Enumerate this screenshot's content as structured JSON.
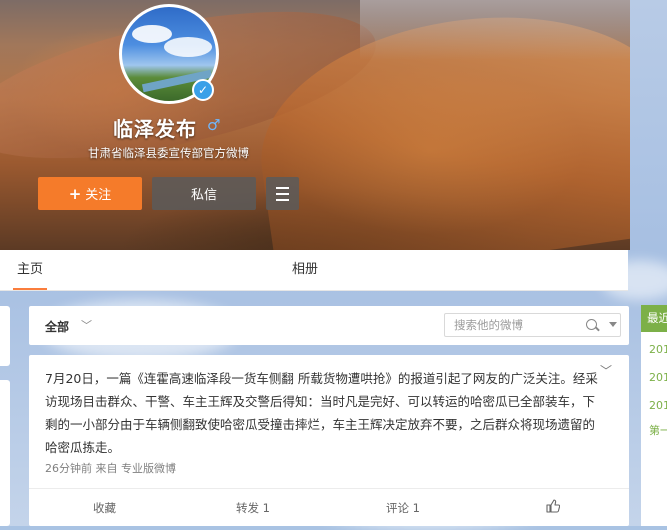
{
  "profile": {
    "name": "临泽发布",
    "gender_symbol": "♂",
    "verified_symbol": "✓",
    "subtitle": "甘肃省临泽县委宣传部官方微博",
    "follow_plus": "+",
    "follow_label": "关注",
    "message_label": "私信"
  },
  "tabs": {
    "home": "主页",
    "album": "相册"
  },
  "filter": {
    "all_label": "全部",
    "chevron": "﹀",
    "search_placeholder": "搜索他的微博"
  },
  "post": {
    "text": "7月20日，一篇《连霍高速临泽段一货车侧翻 所载货物遭哄抢》的报道引起了网友的广泛关注。经采访现场目击群众、干警、车主王辉及交警后得知：当时凡是完好、可以转运的哈密瓜已全部装车，下剩的一小部分由于车辆侧翻致使哈密瓜受撞击摔烂，车主王辉决定放弃不要，之后群众将现场遗留的哈密瓜拣走。",
    "chevron": "﹀",
    "meta": "26分钟前 来自 专业版微博",
    "actions": {
      "favorite": "收藏",
      "repost": "转发 1",
      "comment": "评论 1"
    }
  },
  "right_panel": {
    "header": "最近",
    "items": [
      "201",
      "201",
      "201",
      "第一"
    ]
  },
  "colors": {
    "follow": "#f57b2a",
    "tab_accent": "#fa7d3c",
    "verified": "#3aa0e8",
    "panel_green": "#7cb048"
  }
}
